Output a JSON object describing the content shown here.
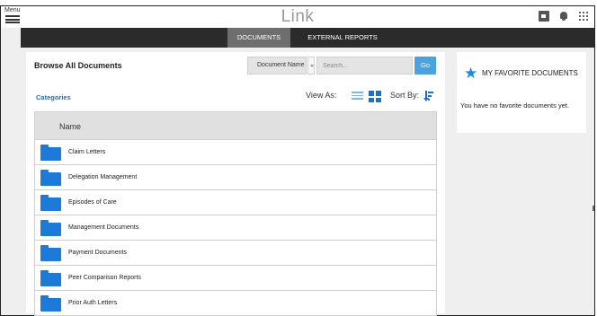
{
  "header": {
    "menu_label": "Menu",
    "app_title": "Link",
    "icons": [
      "document-icon",
      "bell-icon",
      "apps-grid-icon"
    ]
  },
  "nav": {
    "tabs": [
      {
        "label": "DOCUMENTS",
        "active": true
      },
      {
        "label": "EXTERNAL REPORTS",
        "active": false
      }
    ]
  },
  "main": {
    "title": "Browse All Documents",
    "search": {
      "field_select": "Document Name",
      "placeholder": "Search...",
      "go_label": "Go"
    },
    "categories_label": "Categories",
    "view_as_label": "View As:",
    "sort_by_label": "Sort By:",
    "table": {
      "header": "Name",
      "rows": [
        "Claim Letters",
        "Delegation Management",
        "Episodes of Care",
        "Management Documents",
        "Payment Documents",
        "Peer Comparison Reports",
        "Prior Auth Letters"
      ]
    }
  },
  "favorites": {
    "title": "MY FAVORITE DOCUMENTS",
    "empty_message": "You have no favorite documents yet."
  },
  "colors": {
    "accent_blue": "#1e7ad9",
    "go_button": "#4aa3df",
    "navbar": "#2b2b2b",
    "active_tab": "#6e6e6e"
  }
}
